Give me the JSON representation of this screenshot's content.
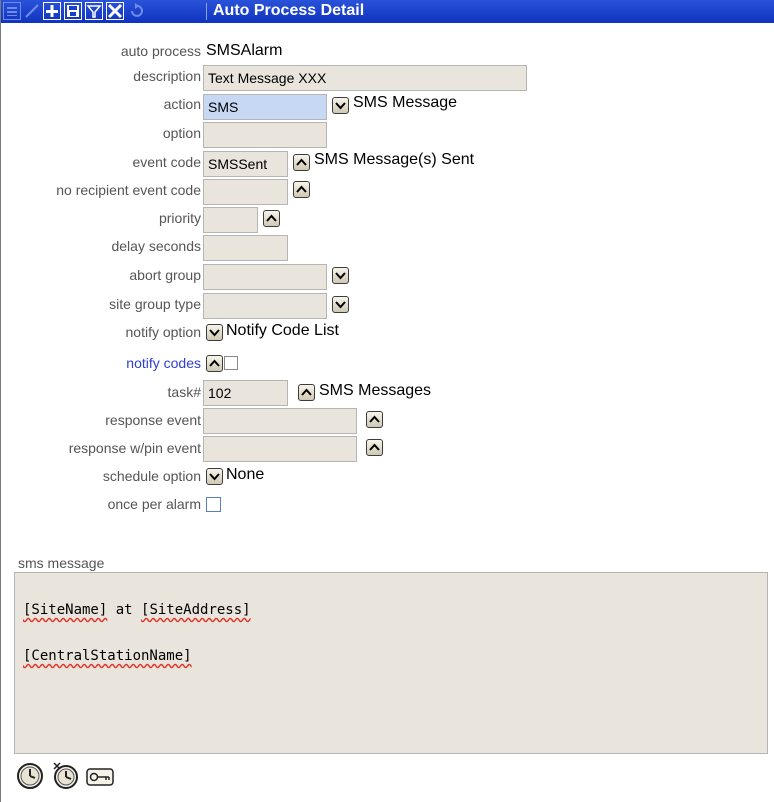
{
  "window": {
    "title": "Auto Process Detail"
  },
  "toolbar": {
    "icons": [
      "menu-icon",
      "edit-icon",
      "add-icon",
      "save-icon",
      "filter-icon",
      "close-icon",
      "refresh-icon"
    ]
  },
  "form": {
    "auto_process": {
      "label": "auto process",
      "value": "SMSAlarm"
    },
    "description": {
      "label": "description",
      "value": "Text Message XXX"
    },
    "action": {
      "label": "action",
      "value": "SMS",
      "text": "SMS Message"
    },
    "option": {
      "label": "option",
      "value": ""
    },
    "event_code": {
      "label": "event code",
      "value": "SMSSent",
      "text": "SMS Message(s) Sent"
    },
    "no_recipient_event_code": {
      "label": "no recipient event code",
      "value": ""
    },
    "priority": {
      "label": "priority",
      "value": ""
    },
    "delay_seconds": {
      "label": "delay seconds",
      "value": ""
    },
    "abort_group": {
      "label": "abort group",
      "value": ""
    },
    "site_group_type": {
      "label": "site group type",
      "value": ""
    },
    "notify_option": {
      "label": "notify option",
      "text": "Notify Code List"
    },
    "notify_codes": {
      "label": "notify codes",
      "checked": false
    },
    "task": {
      "label": "task#",
      "value": "102",
      "text": "SMS Messages"
    },
    "response_event": {
      "label": "response event",
      "value": ""
    },
    "response_pin_event": {
      "label": "response w/pin event",
      "value": ""
    },
    "schedule_option": {
      "label": "schedule option",
      "text": "None"
    },
    "once_per_alarm": {
      "label": "once per alarm",
      "checked": false
    }
  },
  "sms": {
    "label": "sms message",
    "line1": {
      "tok1": "[SiteName]",
      "mid": " at ",
      "tok2": "[SiteAddress]"
    },
    "line2": {
      "tok1": "[CentralStationName]"
    }
  },
  "footer": {
    "icons": [
      "clock-icon",
      "clock-reset-icon",
      "key-icon"
    ]
  }
}
